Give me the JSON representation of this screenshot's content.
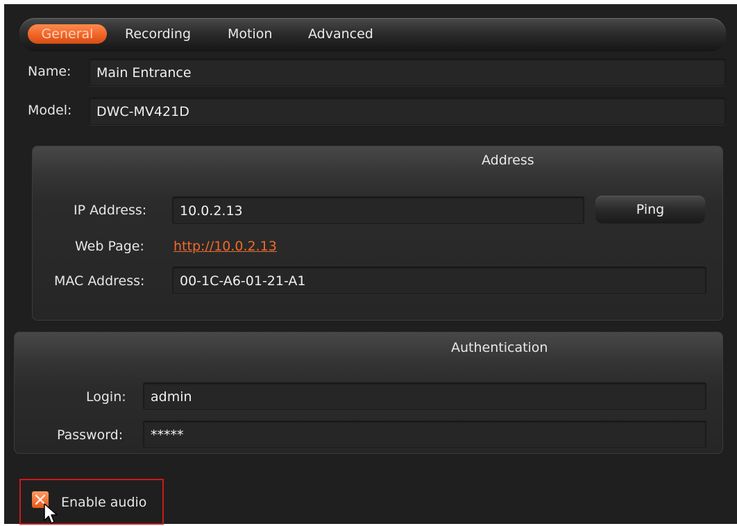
{
  "tabs": [
    {
      "label": "General",
      "active": true
    },
    {
      "label": "Recording",
      "active": false
    },
    {
      "label": "Motion",
      "active": false
    },
    {
      "label": "Advanced",
      "active": false
    }
  ],
  "general": {
    "name_label": "Name:",
    "name_value": "Main Entrance",
    "model_label": "Model:",
    "model_value": "DWC-MV421D"
  },
  "address": {
    "title": "Address",
    "ip_label": "IP Address:",
    "ip_value": "10.0.2.13",
    "ping_label": "Ping",
    "web_label": "Web Page:",
    "web_link": "http://10.0.2.13",
    "mac_label": "MAC Address:",
    "mac_value": "00-1C-A6-01-21-A1"
  },
  "authentication": {
    "title": "Authentication",
    "login_label": "Login:",
    "login_value": "admin",
    "password_label": "Password:",
    "password_value": "*****"
  },
  "audio": {
    "label": "Enable audio",
    "checked": true
  },
  "colors": {
    "accent": "#f06426",
    "link": "#f06a2a",
    "background": "#1f1f1f",
    "highlight_border": "#cc1a1a"
  },
  "icons": {
    "checkbox": "checkbox-checked-icon",
    "cursor": "mouse-pointer-icon"
  }
}
